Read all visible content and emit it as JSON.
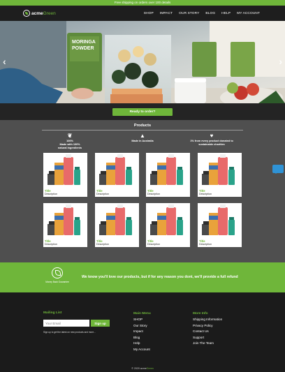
{
  "promo": {
    "text": "Free shipping on orders over 100 details"
  },
  "brand": {
    "name_a": "acme",
    "name_b": "Green"
  },
  "nav": {
    "items": [
      "SHOP",
      "IMPACT",
      "OUR STORY",
      "BLOG",
      "HELP",
      "MY ACCOUNT"
    ]
  },
  "hero": {
    "bag_title": "MORINGA POWDER",
    "cta": "Ready to order?"
  },
  "products": {
    "heading": "Products",
    "features": [
      {
        "line1": "100%",
        "line2": "Made with 100%",
        "line3": "natural ingredients",
        "icon": "leaf-icon"
      },
      {
        "line1": "",
        "line2": "Made in Australia",
        "line3": "",
        "icon": "australia-map-icon"
      },
      {
        "line1": "",
        "line2": "1% from every product donated to",
        "line3": "sustainable charities",
        "icon": "hands-heart-icon"
      }
    ],
    "cards": [
      {
        "title": "Title",
        "desc": "Description"
      },
      {
        "title": "Title",
        "desc": "Description"
      },
      {
        "title": "Title",
        "desc": "Description"
      },
      {
        "title": "Title",
        "desc": "Description"
      },
      {
        "title": "Title",
        "desc": "Description"
      },
      {
        "title": "Title",
        "desc": "Description"
      },
      {
        "title": "Title",
        "desc": "Description"
      },
      {
        "title": "Title",
        "desc": "Description"
      }
    ]
  },
  "guarantee": {
    "icon_label": "Money Back Guarantee",
    "text": "We know you'll love our products, but if for any reason you dont, we'll provide a full refund"
  },
  "footer": {
    "mailing_title": "Mailing List",
    "email_placeholder": "Your Email",
    "signup_label": "Sign up",
    "signup_note": "Sign up to get the latest on new products and more...",
    "main_title": "Main Menu",
    "main_items": [
      "SHOP",
      "Our Story",
      "Impact",
      "Blog",
      "Help",
      "My Account"
    ],
    "info_title": "More Info",
    "info_items": [
      "Shipping Information",
      "Privacy Policy",
      "Contact Us",
      "Support",
      "Join The Team"
    ],
    "copyright_a": "© 2020 acme",
    "copyright_b": "Green"
  },
  "colors": {
    "accent": "#6fb63a",
    "dark": "#1e1e1e",
    "panel": "#4f4f4f",
    "chat": "#2f93d6"
  }
}
